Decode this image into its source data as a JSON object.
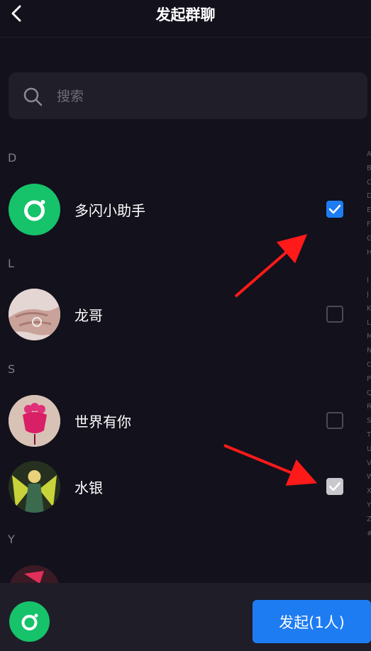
{
  "header": {
    "title": "发起群聊"
  },
  "search": {
    "placeholder": "搜索"
  },
  "sections": [
    {
      "letter": "D",
      "contacts": [
        {
          "name": "多闪小助手",
          "checked": true,
          "avatar": "app-logo"
        }
      ]
    },
    {
      "letter": "L",
      "contacts": [
        {
          "name": "龙哥",
          "checked": false,
          "avatar": "hand-photo"
        }
      ]
    },
    {
      "letter": "S",
      "contacts": [
        {
          "name": "世界有你",
          "checked": false,
          "avatar": "pink-creature"
        },
        {
          "name": "水银",
          "checked": true,
          "disabled": true,
          "avatar": "anime-character"
        }
      ]
    },
    {
      "letter": "Y",
      "contacts": []
    }
  ],
  "index_letters": [
    "A",
    "B",
    "C",
    "D",
    "E",
    "F",
    "G",
    "H",
    "",
    "I",
    "J",
    "K",
    "L",
    "M",
    "N",
    "O",
    "P",
    "Q",
    "R",
    "S",
    "T",
    "U",
    "V",
    "W",
    "X",
    "Y",
    "Z",
    "#"
  ],
  "bottom": {
    "button_label": "发起(1人)"
  },
  "colors": {
    "background": "#12111c",
    "accent": "#1e7cf2",
    "assistant_green": "#16c26a",
    "panel": "#1f1e28"
  }
}
